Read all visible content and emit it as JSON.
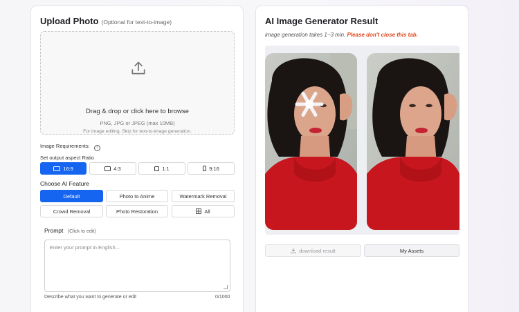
{
  "upload": {
    "title": "Upload Photo",
    "subtitle": "(Optional for text-to-image)",
    "drop_main": "Drag & drop or click here to browse",
    "drop_formats": "PNG, JPG or JPEG (max 10MB)",
    "drop_note": "For image editing. Skip for text-to-image generation.",
    "icon": "upload-icon"
  },
  "requirements": {
    "label": "Image Requirements:",
    "icon": "info-icon"
  },
  "aspect": {
    "label": "Set output aspect Ratio",
    "options": [
      "16:9",
      "4:3",
      "1:1",
      "9:16"
    ],
    "selected": "16:9"
  },
  "feature": {
    "label": "Choose AI Feature",
    "options": [
      "Default",
      "Photo to Anime",
      "Watermark Removal",
      "Crowd Removal",
      "Photo Restoration",
      "All"
    ],
    "selected": "Default"
  },
  "prompt": {
    "label": "Prompt",
    "hint": "(Click to edit)",
    "placeholder": "Enter your prompt in English...",
    "helper": "Describe what you want to generate or edit",
    "counter": "0/1000"
  },
  "result": {
    "title": "AI Image Generator Result",
    "note": "image generation takes 1~3 min.",
    "warning": "Please don't close this tab.",
    "download_label": "download result",
    "assets_label": "My Assets"
  },
  "colors": {
    "accent": "#1565f0",
    "warning": "#e0471b"
  }
}
